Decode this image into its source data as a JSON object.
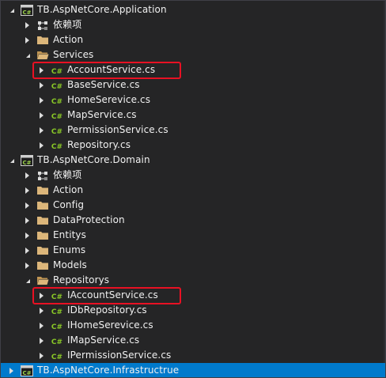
{
  "tree": {
    "rows": [
      {
        "label": "TB.AspNetCore.Application",
        "icon": "csharp-project-icon",
        "expander": "expanded",
        "level": 0
      },
      {
        "label": "依赖项",
        "icon": "dependencies-icon",
        "expander": "collapsed",
        "level": 1
      },
      {
        "label": "Action",
        "icon": "folder-icon",
        "expander": "collapsed",
        "level": 1
      },
      {
        "label": "Services",
        "icon": "folder-open-icon",
        "expander": "expanded",
        "level": 1
      },
      {
        "label": "AccountService.cs",
        "icon": "csharp-file-icon",
        "expander": "collapsed",
        "level": 2,
        "highlighted": true
      },
      {
        "label": "BaseService.cs",
        "icon": "csharp-file-icon",
        "expander": "collapsed",
        "level": 2
      },
      {
        "label": "HomeSerevice.cs",
        "icon": "csharp-file-icon",
        "expander": "collapsed",
        "level": 2
      },
      {
        "label": "MapService.cs",
        "icon": "csharp-file-icon",
        "expander": "collapsed",
        "level": 2
      },
      {
        "label": "PermissionService.cs",
        "icon": "csharp-file-icon",
        "expander": "collapsed",
        "level": 2
      },
      {
        "label": "Repository.cs",
        "icon": "csharp-file-icon",
        "expander": "collapsed",
        "level": 2
      },
      {
        "label": "TB.AspNetCore.Domain",
        "icon": "csharp-project-icon",
        "expander": "expanded",
        "level": 0
      },
      {
        "label": "依赖项",
        "icon": "dependencies-icon",
        "expander": "collapsed",
        "level": 1
      },
      {
        "label": "Action",
        "icon": "folder-icon",
        "expander": "collapsed",
        "level": 1
      },
      {
        "label": "Config",
        "icon": "folder-icon",
        "expander": "collapsed",
        "level": 1
      },
      {
        "label": "DataProtection",
        "icon": "folder-icon",
        "expander": "collapsed",
        "level": 1
      },
      {
        "label": "Entitys",
        "icon": "folder-icon",
        "expander": "collapsed",
        "level": 1
      },
      {
        "label": "Enums",
        "icon": "folder-icon",
        "expander": "collapsed",
        "level": 1
      },
      {
        "label": "Models",
        "icon": "folder-icon",
        "expander": "collapsed",
        "level": 1
      },
      {
        "label": "Repositorys",
        "icon": "folder-open-icon",
        "expander": "expanded",
        "level": 1
      },
      {
        "label": "IAccountService.cs",
        "icon": "csharp-file-icon",
        "expander": "collapsed",
        "level": 2,
        "highlighted": true
      },
      {
        "label": "IDbRepository.cs",
        "icon": "csharp-file-icon",
        "expander": "collapsed",
        "level": 2
      },
      {
        "label": "IHomeSerevice.cs",
        "icon": "csharp-file-icon",
        "expander": "collapsed",
        "level": 2
      },
      {
        "label": "IMapService.cs",
        "icon": "csharp-file-icon",
        "expander": "collapsed",
        "level": 2
      },
      {
        "label": "IPermissionService.cs",
        "icon": "csharp-file-icon",
        "expander": "collapsed",
        "level": 2
      },
      {
        "label": "TB.AspNetCore.Infrastructrue",
        "icon": "csharp-project-icon",
        "expander": "collapsed",
        "level": 0,
        "selected": true
      }
    ]
  },
  "colors": {
    "background": "#252526",
    "text": "#f1f1f1",
    "selection": "#007acc",
    "highlight_box": "#e81123",
    "csharp_green": "#8ac926",
    "folder": "#dcb67a"
  }
}
